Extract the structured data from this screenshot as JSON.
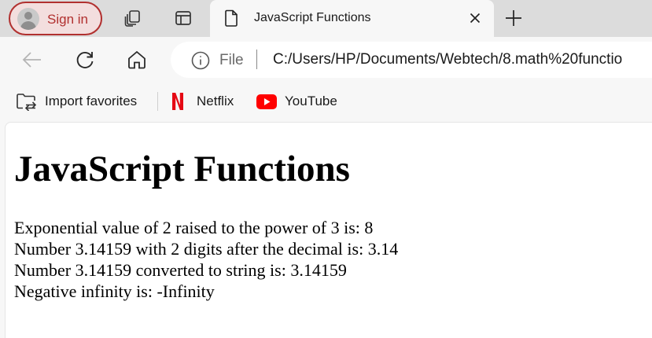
{
  "browser": {
    "profile": {
      "label": "Sign in",
      "icon": "profile-avatar-icon"
    },
    "tabstrip_icons": [
      "workspaces-icon",
      "vertical-tabs-icon"
    ],
    "active_tab": {
      "title": "JavaScript Functions",
      "icon": "document-icon",
      "close_icon": "close-icon"
    },
    "new_tab_icon": "plus-icon",
    "nav": {
      "back_icon": "back-arrow-icon",
      "refresh_icon": "refresh-icon",
      "home_icon": "home-icon"
    },
    "address_bar": {
      "info_icon": "info-icon",
      "scheme_label": "File",
      "url": "C:/Users/HP/Documents/Webtech/8.math%20functio"
    },
    "favorites": [
      {
        "label": "Import favorites",
        "icon": "import-favorites-icon"
      },
      {
        "label": "Netflix",
        "icon": "netflix-icon",
        "color": "#e50914"
      },
      {
        "label": "YouTube",
        "icon": "youtube-icon",
        "color": "#ff0000"
      }
    ]
  },
  "page": {
    "heading": "JavaScript Functions",
    "lines": [
      "Exponential value of 2 raised to the power of 3 is: 8",
      "Number 3.14159 with 2 digits after the decimal is: 3.14",
      "Number 3.14159 converted to string is: 3.14159",
      "Negative infinity is: -Infinity"
    ]
  },
  "colors": {
    "profile_accent": "#b1302f",
    "tabstrip_bg": "#dcdcdc",
    "toolbar_bg": "#f7f7f7",
    "page_bg": "#ffffff"
  }
}
